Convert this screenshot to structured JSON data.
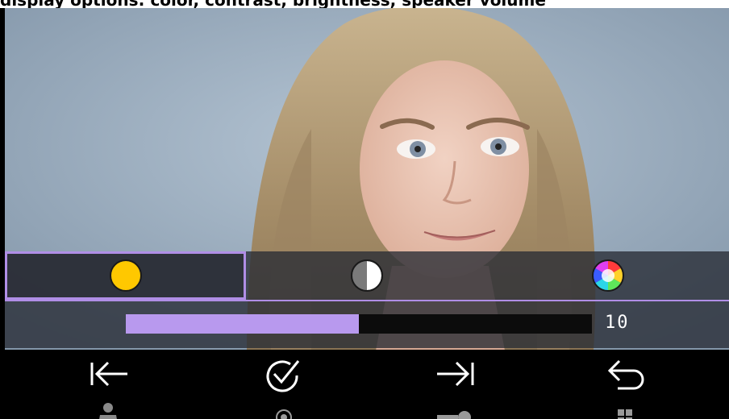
{
  "header": {
    "caption": "display options: color, contrast, brightness, speaker volume"
  },
  "video_feed": {
    "description_icon": "camera-feed"
  },
  "adjust_tabs": [
    {
      "icon": "brightness-sun-icon",
      "selected": true
    },
    {
      "icon": "contrast-half-circle-icon",
      "selected": false
    },
    {
      "icon": "color-wheel-icon",
      "selected": false
    }
  ],
  "slider": {
    "value": "10",
    "fill_fraction": 0.5
  },
  "toolbar": {
    "buttons": [
      {
        "icon": "arrow-left-to-bar-icon",
        "sub_icon": "person-icon"
      },
      {
        "icon": "check-circle-icon",
        "sub_icon": "record-dot-icon"
      },
      {
        "icon": "arrow-right-to-bar-icon",
        "sub_icon": "key-icon"
      },
      {
        "icon": "return-arrow-icon",
        "sub_icon": "grid-icon"
      }
    ]
  },
  "colors": {
    "accent": "#b899ee",
    "sun": "#ffc800",
    "panel": "#2c3038"
  }
}
